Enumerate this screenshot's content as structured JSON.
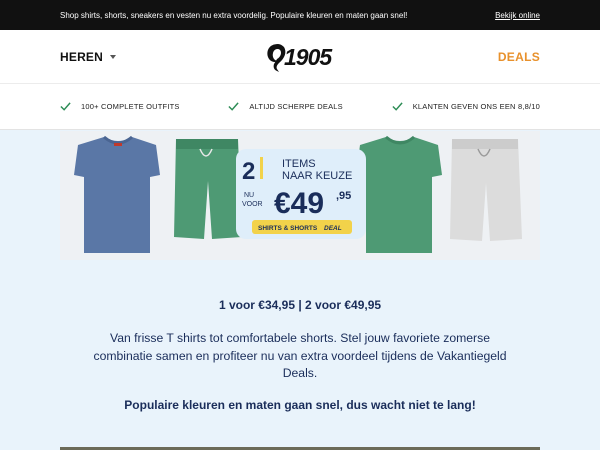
{
  "topbar": {
    "message": "Shop shirts, shorts, sneakers en vesten nu extra voordelig. Populaire kleuren en maten gaan snel!",
    "view_online": "Bekijk online"
  },
  "header": {
    "menu_label": "HEREN",
    "logo_text": "1905",
    "deals_label": "DEALS",
    "deals_color": "#e8912c"
  },
  "usps": [
    {
      "icon": "check-icon",
      "text": "100+ COMPLETE OUTFITS"
    },
    {
      "icon": "check-icon",
      "text": "ALTIJD SCHERPE DEALS"
    },
    {
      "icon": "check-icon",
      "text": "KLANTEN GEVEN ONS EEN 8,8/10"
    }
  ],
  "banner": {
    "big_number": "2",
    "items_line1": "ITEMS",
    "items_line2": "NAAR KEUZE",
    "nu_label": "NU",
    "voor_label": "VOOR",
    "price_main": "€49",
    "price_cents": ",95",
    "tag_text": "SHIRTS & SHORTS",
    "tag_bold": "DEAL",
    "tag_color": "#f2d24a"
  },
  "content": {
    "price_line": "1 voor €34,95 | 2 voor €49,95",
    "description": "Van frisse T shirts tot comfortabele shorts. Stel jouw favoriete zomerse combinatie samen en profiteer nu van extra voordeel tijdens de Vakantiegeld Deals.",
    "cta": "Populaire kleuren en maten gaan snel, dus wacht niet te lang!"
  }
}
